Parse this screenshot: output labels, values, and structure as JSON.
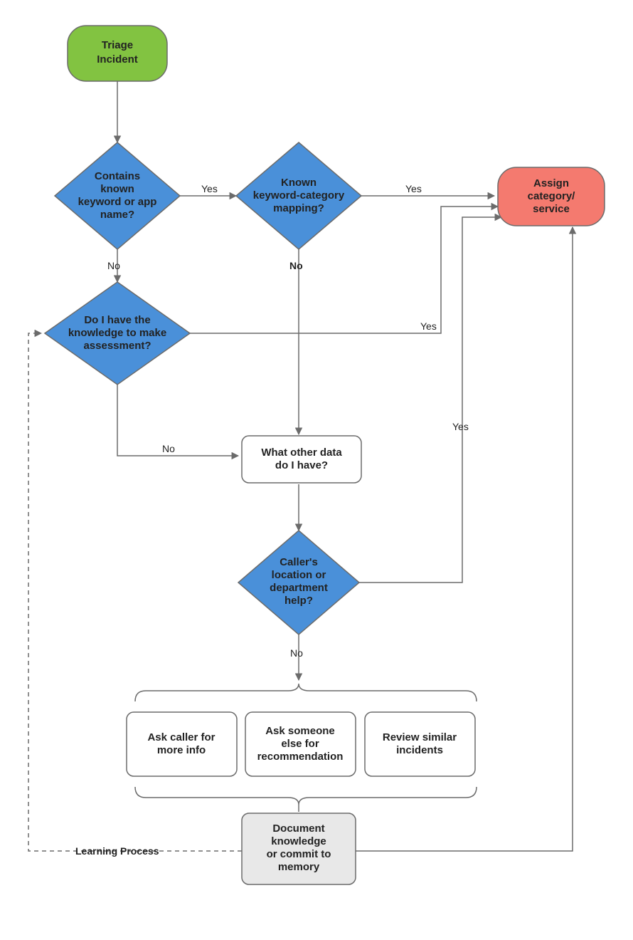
{
  "nodes": {
    "start": {
      "line1": "Triage",
      "line2": "Incident"
    },
    "keyword": {
      "line1": "Contains",
      "line2": "known",
      "line3": "keyword or app",
      "line4": "name?"
    },
    "mapping": {
      "line1": "Known",
      "line2": "keyword-category",
      "line3": "mapping?"
    },
    "assign": {
      "line1": "Assign",
      "line2": "category/",
      "line3": "service"
    },
    "knowledge": {
      "line1": "Do I have the",
      "line2": "knowledge to make",
      "line3": "assessment?"
    },
    "otherdata": {
      "line1": "What other data",
      "line2": "do I have?"
    },
    "caller": {
      "line1": "Caller's",
      "line2": "location or",
      "line3": "department",
      "line4": "help?"
    },
    "askcaller": {
      "line1": "Ask caller for",
      "line2": "more info"
    },
    "askelse": {
      "line1": "Ask someone",
      "line2": "else for",
      "line3": "recommendation"
    },
    "review": {
      "line1": "Review similar",
      "line2": "incidents"
    },
    "document": {
      "line1": "Document",
      "line2": "knowledge",
      "line3": "or commit to",
      "line4": "memory"
    }
  },
  "labels": {
    "yes": "Yes",
    "no": "No",
    "learning": "Learning Process"
  },
  "colors": {
    "green_fill": "#82c341",
    "green_stroke": "#6b6b6b",
    "blue_fill": "#4a90d9",
    "blue_stroke": "#6b6b6b",
    "salmon_fill": "#f47a6f",
    "salmon_stroke": "#6b6b6b",
    "white_fill": "#ffffff",
    "gray_fill": "#e8e8e8",
    "node_stroke": "#6b6b6b",
    "edge": "#6b6b6b"
  }
}
